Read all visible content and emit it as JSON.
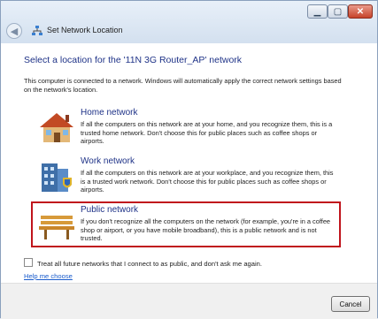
{
  "window": {
    "title": "Set Network Location",
    "controls": {
      "minimize_icon": "minimize-icon",
      "maximize_icon": "maximize-icon",
      "close_icon": "close-icon"
    }
  },
  "content": {
    "heading": "Select a location for the '11N 3G Router_AP' network",
    "intro": "This computer is connected to a network. Windows will automatically apply the correct network settings based on the network's location.",
    "options": [
      {
        "title": "Home network",
        "description": "If all the computers on this network are at your home, and you recognize them, this is a trusted home network.  Don't choose this for public places such as coffee shops or airports.",
        "icon": "home-network-icon"
      },
      {
        "title": "Work network",
        "description": "If all the computers on this network are at your workplace, and you recognize them, this is a trusted work network.  Don't choose this for public places such as coffee shops or airports.",
        "icon": "work-network-icon"
      },
      {
        "title": "Public network",
        "description": "If you don't recognize all the computers on the network (for example, you're in a coffee shop or airport, or you have mobile broadband), this is a public network and is not trusted.",
        "icon": "public-network-icon"
      }
    ],
    "checkbox_label": "Treat all future networks that I connect to as public, and don't ask me again.",
    "checkbox_checked": false,
    "help_link": "Help me choose"
  },
  "footer": {
    "cancel_label": "Cancel"
  },
  "colors": {
    "accent": "#1e3287",
    "selection": "#c0141c",
    "link": "#1a5ccc"
  }
}
